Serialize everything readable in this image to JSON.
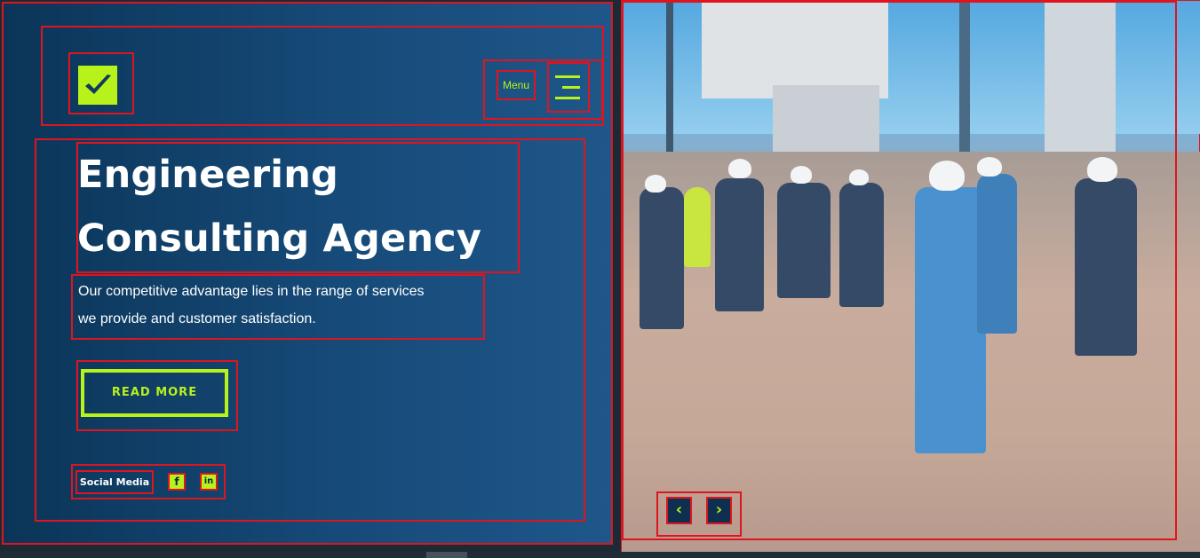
{
  "header": {
    "logo_icon": "checkmark-icon",
    "menu_label": "Menu",
    "menu_icon": "hamburger-icon"
  },
  "hero": {
    "title_line1": "Engineering",
    "title_line2": "Consulting Agency",
    "description_line1": "Our competitive advantage lies in the range of services",
    "description_line2": "we provide and customer satisfaction.",
    "cta_label": "READ MORE",
    "social_label": "Social Media",
    "social_links": [
      {
        "icon": "facebook-icon",
        "glyph": "f"
      },
      {
        "icon": "linkedin-icon",
        "glyph": "in"
      }
    ]
  },
  "slider": {
    "prev_glyph": "‹",
    "next_glyph": "›",
    "image_icon": "construction-site-photo"
  },
  "colors": {
    "accent": "#b7f21b",
    "panel_dark": "#0b3558",
    "panel_light": "#1f578a",
    "outline": "#e0141e"
  }
}
